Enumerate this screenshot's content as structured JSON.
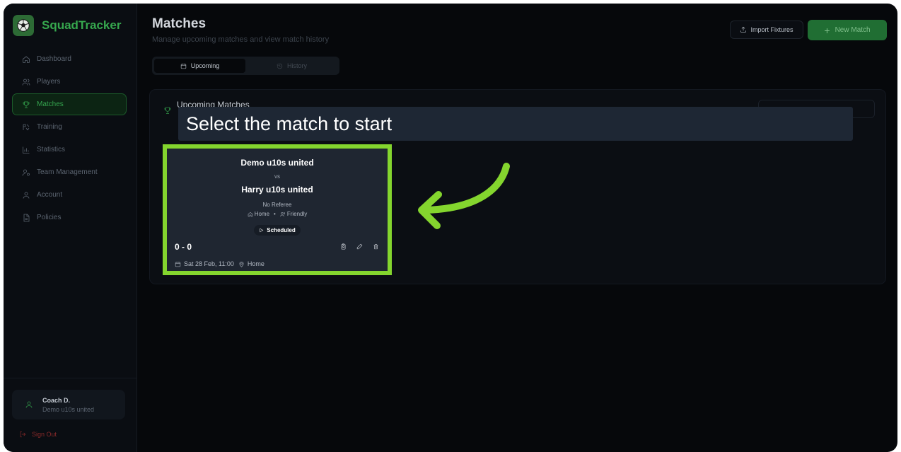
{
  "app": {
    "brand": "SquadTracker",
    "accent": "#36a84e",
    "highlight": "#84d52e"
  },
  "sidebar": {
    "items": [
      {
        "label": "Dashboard",
        "icon": "home-icon",
        "active": false
      },
      {
        "label": "Players",
        "icon": "users-icon",
        "active": false
      },
      {
        "label": "Matches",
        "icon": "trophy-icon",
        "active": true
      },
      {
        "label": "Training",
        "icon": "training-icon",
        "active": false
      },
      {
        "label": "Statistics",
        "icon": "bar-chart-icon",
        "active": false
      },
      {
        "label": "Team Management",
        "icon": "team-icon",
        "active": false
      },
      {
        "label": "Account",
        "icon": "user-icon",
        "active": false
      },
      {
        "label": "Policies",
        "icon": "document-icon",
        "active": false
      }
    ],
    "user": {
      "name": "Coach D.",
      "team": "Demo u10s united"
    },
    "sign_out": "Sign Out"
  },
  "header": {
    "title": "Matches",
    "subtitle": "Manage upcoming matches and view match history",
    "import_label": "Import Fixtures",
    "new_match_label": "New Match"
  },
  "tabs": [
    {
      "label": "Upcoming",
      "active": true
    },
    {
      "label": "History",
      "active": false
    }
  ],
  "panel": {
    "title": "Upcoming Matches"
  },
  "tooltip": {
    "text": "Select the match to start"
  },
  "match": {
    "home_team": "Demo u10s united",
    "vs": "vs",
    "away_team": "Harry u10s united",
    "referee": "No Referee",
    "venue_type": "Home",
    "match_type": "Friendly",
    "status": "Scheduled",
    "score": "0 - 0",
    "date": "Sat 28 Feb, 11:00",
    "location": "Home"
  }
}
